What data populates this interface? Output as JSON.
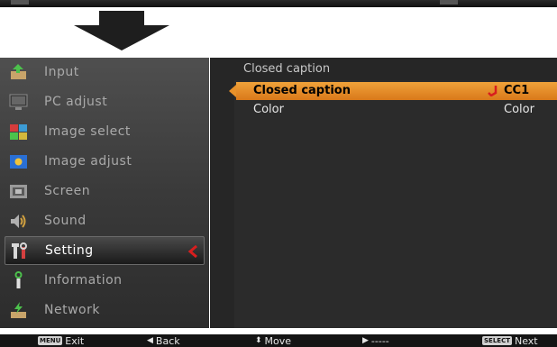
{
  "sidebar": {
    "items": [
      {
        "label": "Input",
        "icon": "input-icon"
      },
      {
        "label": "PC adjust",
        "icon": "monitor-icon"
      },
      {
        "label": "Image select",
        "icon": "image-select-icon"
      },
      {
        "label": "Image adjust",
        "icon": "image-adjust-icon"
      },
      {
        "label": "Screen",
        "icon": "screen-icon"
      },
      {
        "label": "Sound",
        "icon": "speaker-icon"
      },
      {
        "label": "Setting",
        "icon": "setting-tools-icon",
        "active": true
      },
      {
        "label": "Information",
        "icon": "information-icon"
      },
      {
        "label": "Network",
        "icon": "network-icon"
      }
    ]
  },
  "panel": {
    "title": "Closed caption",
    "options": [
      {
        "label": "Closed caption",
        "value": "CC1",
        "selected": true
      },
      {
        "label": "Color",
        "value": "Color",
        "selected": false
      }
    ]
  },
  "bottom_bar": {
    "exit": {
      "key": "MENU",
      "label": "Exit"
    },
    "back": {
      "glyph": "◀",
      "label": "Back"
    },
    "move": {
      "glyph": "⬍",
      "label": "Move"
    },
    "next_arrow": {
      "glyph": "▶",
      "label": "-----"
    },
    "next": {
      "key": "SELECT",
      "label": "Next"
    }
  },
  "colors": {
    "highlight": "#e8912a",
    "pointer_red": "#d81e1e",
    "sidebar_bg": "#3a3a3a",
    "panel_bg": "#262626"
  }
}
